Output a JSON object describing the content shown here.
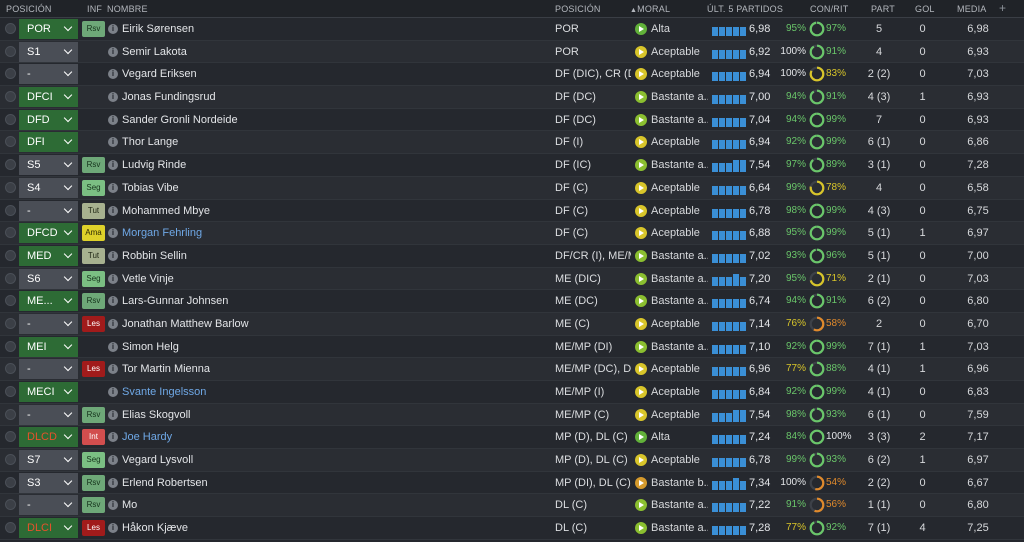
{
  "header": {
    "posicion": "POSICIÓN",
    "inf": "INF",
    "nombre": "NOMBRE",
    "posicion2": "POSICIÓN",
    "moral": "MORAL",
    "ult5": "ÚLT. 5 PARTIDOS",
    "conrit": "CON/RIT",
    "part": "PART",
    "gol": "GOL",
    "media": "MEDIA",
    "add": "+"
  },
  "colors": {
    "green": "#6ac66a",
    "yellow": "#d8c52a",
    "orange": "#e08a2c",
    "red": "#e2522c",
    "bar_blue": "#3a8fd6",
    "pos_green": "#2d6b35",
    "pos_grey": "#4a4e56"
  },
  "players": [
    {
      "pos": "POR",
      "sel": "green",
      "badge": "Rsv",
      "badge_class": "rsv",
      "name": "Eirik Sørensen",
      "link": false,
      "position": "POR",
      "moral_icon": "m-alta",
      "moral": "Alta",
      "bars": [
        9,
        9,
        9,
        9,
        9
      ],
      "rating": "6,98",
      "con": "95%",
      "con_c": "c-green",
      "rit": "97%",
      "rit_c": "c-green",
      "rit_pct": 97,
      "part": "5",
      "gol": "0",
      "media": "6,98"
    },
    {
      "pos": "S1",
      "sel": "grey",
      "badge": "",
      "badge_class": "",
      "name": "Semir Lakota",
      "link": false,
      "position": "POR",
      "moral_icon": "m-aceptable",
      "moral": "Aceptable",
      "bars": [
        9,
        9,
        9,
        9,
        9
      ],
      "rating": "6,92",
      "con": "100%",
      "con_c": "c-white",
      "rit": "91%",
      "rit_c": "c-green",
      "rit_pct": 91,
      "part": "4",
      "gol": "0",
      "media": "6,93"
    },
    {
      "pos": "-",
      "sel": "grey",
      "badge": "",
      "badge_class": "",
      "name": "Vegard Eriksen",
      "link": false,
      "position": "DF (DIC), CR (D)",
      "moral_icon": "m-aceptable",
      "moral": "Aceptable",
      "bars": [
        9,
        9,
        9,
        9,
        9
      ],
      "rating": "6,94",
      "con": "100%",
      "con_c": "c-white",
      "rit": "83%",
      "rit_c": "c-yellow",
      "rit_pct": 83,
      "part": "2 (2)",
      "gol": "0",
      "media": "7,03"
    },
    {
      "pos": "DFCI",
      "sel": "green",
      "badge": "",
      "badge_class": "",
      "name": "Jonas Fundingsrud",
      "link": false,
      "position": "DF (DC)",
      "moral_icon": "m-bastante",
      "moral": "Bastante a...",
      "bars": [
        9,
        9,
        9,
        9,
        9
      ],
      "rating": "7,00",
      "con": "94%",
      "con_c": "c-green",
      "rit": "91%",
      "rit_c": "c-green",
      "rit_pct": 91,
      "part": "4 (3)",
      "gol": "1",
      "media": "6,93"
    },
    {
      "pos": "DFD",
      "sel": "green",
      "badge": "",
      "badge_class": "",
      "name": "Sander Gronli Nordeide",
      "link": false,
      "position": "DF (DC)",
      "moral_icon": "m-bastante",
      "moral": "Bastante a...",
      "bars": [
        9,
        9,
        9,
        9,
        9
      ],
      "rating": "7,04",
      "con": "94%",
      "con_c": "c-green",
      "rit": "99%",
      "rit_c": "c-green",
      "rit_pct": 99,
      "part": "7",
      "gol": "0",
      "media": "6,93"
    },
    {
      "pos": "DFI",
      "sel": "green",
      "badge": "",
      "badge_class": "",
      "name": "Thor Lange",
      "link": false,
      "position": "DF (I)",
      "moral_icon": "m-aceptable",
      "moral": "Aceptable",
      "bars": [
        9,
        9,
        9,
        9,
        9
      ],
      "rating": "6,94",
      "con": "92%",
      "con_c": "c-green",
      "rit": "99%",
      "rit_c": "c-green",
      "rit_pct": 99,
      "part": "6 (1)",
      "gol": "0",
      "media": "6,86"
    },
    {
      "pos": "S5",
      "sel": "grey",
      "badge": "Rsv",
      "badge_class": "rsv",
      "name": "Ludvig Rinde",
      "link": false,
      "position": "DF (IC)",
      "moral_icon": "m-bastante",
      "moral": "Bastante a...",
      "bars": [
        9,
        9,
        9,
        12,
        12
      ],
      "rating": "7,54",
      "con": "97%",
      "con_c": "c-green",
      "rit": "89%",
      "rit_c": "c-green",
      "rit_pct": 89,
      "part": "3 (1)",
      "gol": "0",
      "media": "7,28"
    },
    {
      "pos": "S4",
      "sel": "grey",
      "badge": "Seg",
      "badge_class": "seg",
      "name": "Tobias Vibe",
      "link": false,
      "position": "DF (C)",
      "moral_icon": "m-aceptable",
      "moral": "Aceptable",
      "bars": [
        9,
        9,
        9,
        9,
        9
      ],
      "rating": "6,64",
      "con": "99%",
      "con_c": "c-green",
      "rit": "78%",
      "rit_c": "c-yellow",
      "rit_pct": 78,
      "part": "4",
      "gol": "0",
      "media": "6,58"
    },
    {
      "pos": "-",
      "sel": "grey",
      "badge": "Tut",
      "badge_class": "tut",
      "name": "Mohammed Mbye",
      "link": false,
      "position": "DF (C)",
      "moral_icon": "m-aceptable",
      "moral": "Aceptable",
      "bars": [
        9,
        9,
        9,
        9,
        9
      ],
      "rating": "6,78",
      "con": "98%",
      "con_c": "c-green",
      "rit": "99%",
      "rit_c": "c-green",
      "rit_pct": 99,
      "part": "4 (3)",
      "gol": "0",
      "media": "6,75"
    },
    {
      "pos": "DFCD",
      "sel": "green",
      "badge": "Ama",
      "badge_class": "ama",
      "name": "Morgan Fehrling",
      "link": true,
      "position": "DF (C)",
      "moral_icon": "m-aceptable",
      "moral": "Aceptable",
      "bars": [
        9,
        9,
        9,
        9,
        9
      ],
      "rating": "6,88",
      "con": "95%",
      "con_c": "c-green",
      "rit": "99%",
      "rit_c": "c-green",
      "rit_pct": 99,
      "part": "5 (1)",
      "gol": "1",
      "media": "6,97"
    },
    {
      "pos": "MED",
      "sel": "green",
      "badge": "Tut",
      "badge_class": "tut",
      "name": "Robbin Sellin",
      "link": false,
      "position": "DF/CR (I), ME/M...",
      "moral_icon": "m-bastante",
      "moral": "Bastante a...",
      "bars": [
        9,
        9,
        9,
        9,
        9
      ],
      "rating": "7,02",
      "con": "93%",
      "con_c": "c-green",
      "rit": "96%",
      "rit_c": "c-green",
      "rit_pct": 96,
      "part": "5 (1)",
      "gol": "0",
      "media": "7,00"
    },
    {
      "pos": "S6",
      "sel": "grey",
      "badge": "Seg",
      "badge_class": "seg",
      "name": "Vetle Vinje",
      "link": false,
      "position": "ME (DIC)",
      "moral_icon": "m-bastante",
      "moral": "Bastante a...",
      "bars": [
        9,
        9,
        9,
        12,
        9
      ],
      "rating": "7,20",
      "con": "95%",
      "con_c": "c-green",
      "rit": "71%",
      "rit_c": "c-yellow",
      "rit_pct": 71,
      "part": "2 (1)",
      "gol": "0",
      "media": "7,03"
    },
    {
      "pos": "ME...",
      "sel": "green",
      "badge": "Rsv",
      "badge_class": "rsv",
      "name": "Lars-Gunnar Johnsen",
      "link": false,
      "position": "ME (DC)",
      "moral_icon": "m-bastante",
      "moral": "Bastante a...",
      "bars": [
        9,
        9,
        9,
        9,
        9
      ],
      "rating": "6,74",
      "con": "94%",
      "con_c": "c-green",
      "rit": "91%",
      "rit_c": "c-green",
      "rit_pct": 91,
      "part": "6 (2)",
      "gol": "0",
      "media": "6,80"
    },
    {
      "pos": "-",
      "sel": "grey",
      "badge": "Les",
      "badge_class": "les",
      "name": "Jonathan Matthew Barlow",
      "link": false,
      "position": "ME (C)",
      "moral_icon": "m-aceptable",
      "moral": "Aceptable",
      "bars": [
        9,
        9,
        9,
        9,
        9
      ],
      "rating": "7,14",
      "con": "76%",
      "con_c": "c-yellow",
      "rit": "58%",
      "rit_c": "c-orange",
      "rit_pct": 58,
      "part": "2",
      "gol": "0",
      "media": "6,70"
    },
    {
      "pos": "MEI",
      "sel": "green",
      "badge": "",
      "badge_class": "",
      "name": "Simon Helg",
      "link": false,
      "position": "ME/MP (DI)",
      "moral_icon": "m-bastante",
      "moral": "Bastante a...",
      "bars": [
        9,
        9,
        9,
        9,
        9
      ],
      "rating": "7,10",
      "con": "92%",
      "con_c": "c-green",
      "rit": "99%",
      "rit_c": "c-green",
      "rit_pct": 99,
      "part": "7 (1)",
      "gol": "1",
      "media": "7,03"
    },
    {
      "pos": "-",
      "sel": "grey",
      "badge": "Les",
      "badge_class": "les",
      "name": "Tor Martin Mienna",
      "link": false,
      "position": "ME/MP (DC), DL...",
      "moral_icon": "m-aceptable",
      "moral": "Aceptable",
      "bars": [
        9,
        9,
        9,
        9,
        9
      ],
      "rating": "6,96",
      "con": "77%",
      "con_c": "c-yellow",
      "rit": "88%",
      "rit_c": "c-green",
      "rit_pct": 88,
      "part": "4 (1)",
      "gol": "1",
      "media": "6,96"
    },
    {
      "pos": "MECI",
      "sel": "green",
      "badge": "",
      "badge_class": "",
      "name": "Svante Ingelsson",
      "link": true,
      "position": "ME/MP (I)",
      "moral_icon": "m-aceptable",
      "moral": "Aceptable",
      "bars": [
        9,
        9,
        9,
        9,
        9
      ],
      "rating": "6,84",
      "con": "92%",
      "con_c": "c-green",
      "rit": "99%",
      "rit_c": "c-green",
      "rit_pct": 99,
      "part": "4 (1)",
      "gol": "0",
      "media": "6,83"
    },
    {
      "pos": "-",
      "sel": "grey",
      "badge": "Rsv",
      "badge_class": "rsv",
      "name": "Elias Skogvoll",
      "link": false,
      "position": "ME/MP (C)",
      "moral_icon": "m-aceptable",
      "moral": "Aceptable",
      "bars": [
        9,
        9,
        9,
        12,
        12
      ],
      "rating": "7,54",
      "con": "98%",
      "con_c": "c-green",
      "rit": "93%",
      "rit_c": "c-green",
      "rit_pct": 93,
      "part": "6 (1)",
      "gol": "0",
      "media": "7,59"
    },
    {
      "pos": "DLCD",
      "pos_red": true,
      "sel": "green",
      "badge": "Int",
      "badge_class": "int",
      "name": "Joe Hardy",
      "link": true,
      "position": "MP (D), DL (C)",
      "moral_icon": "m-alta",
      "moral": "Alta",
      "bars": [
        9,
        9,
        9,
        9,
        9
      ],
      "rating": "7,24",
      "con": "84%",
      "con_c": "c-green",
      "rit": "100%",
      "rit_c": "c-white",
      "rit_pct": 100,
      "part": "3 (3)",
      "gol": "2",
      "media": "7,17"
    },
    {
      "pos": "S7",
      "sel": "grey",
      "badge": "Seg",
      "badge_class": "seg",
      "name": "Vegard Lysvoll",
      "link": false,
      "position": "MP (D), DL (C)",
      "moral_icon": "m-aceptable",
      "moral": "Aceptable",
      "bars": [
        9,
        9,
        9,
        9,
        9
      ],
      "rating": "6,78",
      "con": "99%",
      "con_c": "c-green",
      "rit": "93%",
      "rit_c": "c-green",
      "rit_pct": 93,
      "part": "6 (2)",
      "gol": "1",
      "media": "6,97"
    },
    {
      "pos": "S3",
      "sel": "grey",
      "badge": "Rsv",
      "badge_class": "rsv",
      "name": "Erlend Robertsen",
      "link": false,
      "position": "MP (DI), DL (C)",
      "moral_icon": "m-bastante-b",
      "moral": "Bastante b...",
      "bars": [
        9,
        9,
        9,
        12,
        9
      ],
      "rating": "7,34",
      "con": "100%",
      "con_c": "c-white",
      "rit": "54%",
      "rit_c": "c-orange",
      "rit_pct": 54,
      "part": "2 (2)",
      "gol": "0",
      "media": "6,67"
    },
    {
      "pos": "-",
      "sel": "grey",
      "badge": "Rsv",
      "badge_class": "rsv",
      "name": "Mo",
      "link": false,
      "position": "DL (C)",
      "moral_icon": "m-bastante",
      "moral": "Bastante a...",
      "bars": [
        9,
        9,
        9,
        9,
        9
      ],
      "rating": "7,22",
      "con": "91%",
      "con_c": "c-green",
      "rit": "56%",
      "rit_c": "c-orange",
      "rit_pct": 56,
      "part": "1 (1)",
      "gol": "0",
      "media": "6,80"
    },
    {
      "pos": "DLCI",
      "pos_red": true,
      "sel": "green",
      "badge": "Les",
      "badge_class": "les",
      "name": "Håkon Kjæve",
      "link": false,
      "position": "DL (C)",
      "moral_icon": "m-bastante",
      "moral": "Bastante a...",
      "bars": [
        9,
        9,
        9,
        9,
        9
      ],
      "rating": "7,28",
      "con": "77%",
      "con_c": "c-yellow",
      "rit": "92%",
      "rit_c": "c-green",
      "rit_pct": 92,
      "part": "7 (1)",
      "gol": "4",
      "media": "7,25"
    }
  ]
}
